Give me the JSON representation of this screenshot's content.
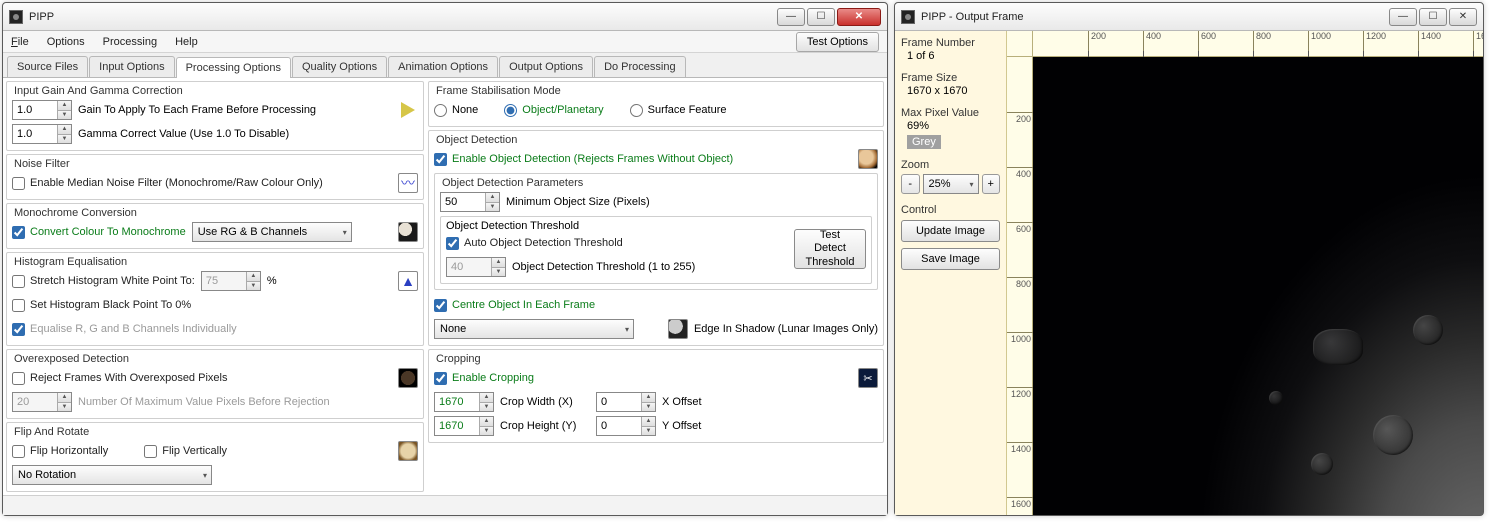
{
  "main_window": {
    "title": "PIPP",
    "menu": {
      "file": "File",
      "options": "Options",
      "processing": "Processing",
      "help": "Help"
    },
    "test_options": "Test Options",
    "tabs": [
      "Source Files",
      "Input Options",
      "Processing Options",
      "Quality Options",
      "Animation Options",
      "Output Options",
      "Do Processing"
    ],
    "active_tab": 2
  },
  "left": {
    "gain": {
      "legend": "Input Gain And Gamma Correction",
      "gain_val": "1.0",
      "gain_label": "Gain To Apply To Each Frame Before Processing",
      "gamma_val": "1.0",
      "gamma_label": "Gamma Correct Value (Use 1.0 To Disable)"
    },
    "noise": {
      "legend": "Noise Filter",
      "enable": "Enable Median Noise Filter (Monochrome/Raw Colour Only)",
      "checked": false
    },
    "mono": {
      "legend": "Monochrome Conversion",
      "enable": "Convert Colour To Monochrome",
      "checked": true,
      "combo": "Use RG & B Channels"
    },
    "hist": {
      "legend": "Histogram Equalisation",
      "stretch": "Stretch Histogram White Point To:",
      "stretch_checked": false,
      "stretch_val": "75",
      "pct": "%",
      "black": "Set Histogram Black Point To 0%",
      "black_checked": false,
      "equalise": "Equalise R, G and B Channels Individually",
      "equalise_checked": true
    },
    "over": {
      "legend": "Overexposed Detection",
      "reject": "Reject Frames With Overexposed Pixels",
      "reject_checked": false,
      "val": "20",
      "label": "Number Of Maximum Value Pixels Before Rejection"
    },
    "flip": {
      "legend": "Flip And Rotate",
      "h": "Flip Horizontally",
      "h_checked": false,
      "v": "Flip Vertically",
      "v_checked": false,
      "combo": "No Rotation"
    }
  },
  "right": {
    "stab": {
      "legend": "Frame Stabilisation Mode",
      "none": "None",
      "objplan": "Object/Planetary",
      "surf": "Surface Feature",
      "selected": "objplan"
    },
    "objdet": {
      "legend": "Object Detection",
      "enable": "Enable Object Detection (Rejects Frames Without Object)",
      "enable_checked": true,
      "params_legend": "Object Detection Parameters",
      "minsize_val": "50",
      "minsize_label": "Minimum Object Size (Pixels)",
      "thresh_legend": "Object Detection Threshold",
      "auto": "Auto Object Detection Threshold",
      "auto_checked": true,
      "thresh_val": "40",
      "thresh_label": "Object Detection Threshold (1 to 255)",
      "test_btn": "Test Detect Threshold"
    },
    "centre": {
      "enable": "Centre Object In Each Frame",
      "enable_checked": true,
      "combo": "None",
      "edge": "Edge In Shadow (Lunar Images Only)"
    },
    "crop": {
      "legend": "Cropping",
      "enable": "Enable Cropping",
      "enable_checked": true,
      "w_val": "1670",
      "w_label": "Crop Width (X)",
      "xo_val": "0",
      "xo_label": "X Offset",
      "h_val": "1670",
      "h_label": "Crop Height (Y)",
      "yo_val": "0",
      "yo_label": "Y Offset"
    }
  },
  "preview": {
    "title": "PIPP - Output Frame",
    "frame_num_label": "Frame Number",
    "frame_num": "1 of 6",
    "frame_size_label": "Frame Size",
    "frame_size": "1670 x 1670",
    "max_px_label": "Max Pixel Value",
    "max_px": "69%",
    "mode": "Grey",
    "zoom_label": "Zoom",
    "zoom": "25%",
    "control_label": "Control",
    "update": "Update Image",
    "save": "Save Image",
    "ruler_ticks": [
      "200",
      "400",
      "600",
      "800",
      "1000",
      "1200",
      "1400",
      "1600"
    ]
  }
}
